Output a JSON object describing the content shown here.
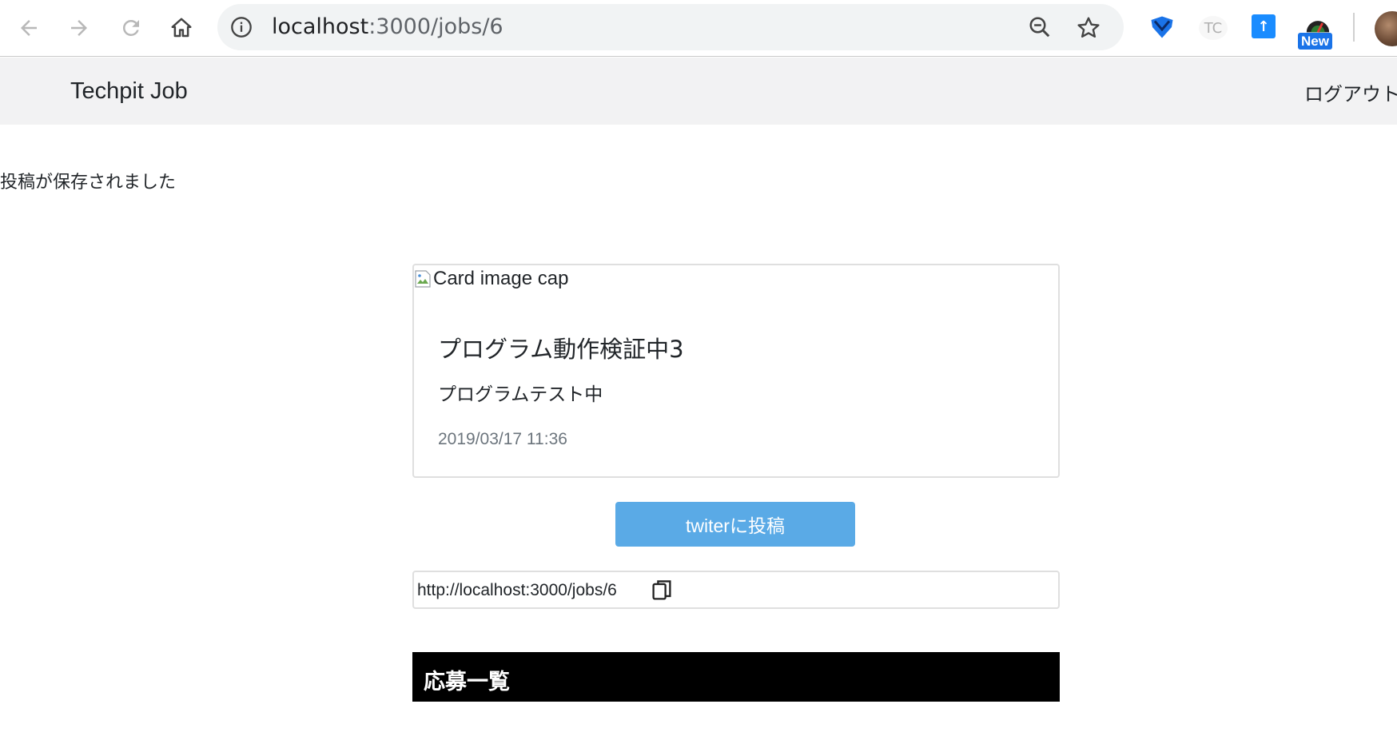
{
  "browser": {
    "url_host": "localhost",
    "url_path": ":3000/jobs/6",
    "extensions": {
      "tc_label": "TC",
      "new_badge": "New"
    }
  },
  "navbar": {
    "brand": "Techpit Job",
    "logout_label": "ログアウト"
  },
  "flash_message": "投稿が保存されました",
  "job_card": {
    "image_alt": "Card image cap",
    "title": "プログラム動作検証中3",
    "description": "プログラムテスト中",
    "date": "2019/03/17 11:36"
  },
  "tweet_button_label": "twiterに投稿",
  "share_url": "http://localhost:3000/jobs/6",
  "applicants_heading": "応募一覧",
  "colors": {
    "tweet_button": "#5aaae6",
    "navbar_bg": "#f2f2f3",
    "applicants_bar": "#000000"
  }
}
